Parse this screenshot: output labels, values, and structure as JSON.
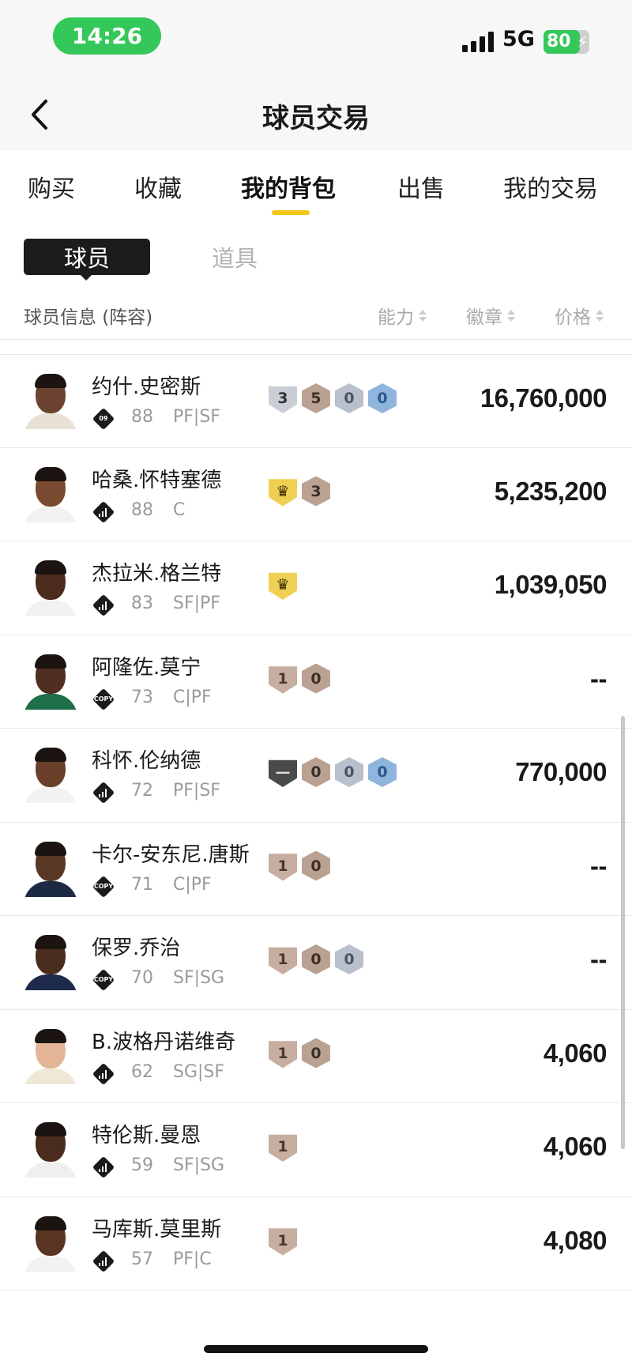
{
  "status_bar": {
    "time": "14:26",
    "network": "5G",
    "battery": "80",
    "battery_level": 0.8
  },
  "nav": {
    "title": "球员交易"
  },
  "main_tabs": [
    {
      "label": "购买"
    },
    {
      "label": "收藏"
    },
    {
      "label": "我的背包",
      "active": true
    },
    {
      "label": "出售"
    },
    {
      "label": "我的交易"
    }
  ],
  "sub_tabs": [
    {
      "label": "球员",
      "active": true
    },
    {
      "label": "道具"
    }
  ],
  "columns": {
    "info": "球员信息 (阵容)",
    "ability": "能力",
    "badge": "徽章",
    "price": "价格"
  },
  "colors": {
    "accent": "#f5c518",
    "status_green": "#34c759"
  },
  "players": [
    {
      "name": "约什.史密斯",
      "card": "09",
      "rating": "88",
      "position": "PF|SF",
      "price": "16,760,000",
      "skin": "#6b4330",
      "jersey": "#e8e2d6",
      "badges": [
        {
          "type": "shield",
          "text": "3",
          "bg": "#c9ced6",
          "fg": "#333"
        },
        {
          "type": "hex",
          "text": "5",
          "bg": "#b9a292",
          "fg": "#3d2f26"
        },
        {
          "type": "hex",
          "text": "0",
          "bg": "#b8c0cc",
          "fg": "#4a5568"
        },
        {
          "type": "hex",
          "text": "0",
          "bg": "#8fb5dd",
          "fg": "#2e5a8a"
        }
      ]
    },
    {
      "name": "哈桑.怀特塞德",
      "card": "bars",
      "rating": "88",
      "position": "C",
      "price": "5,235,200",
      "skin": "#7a4a30",
      "jersey": "#f2f2f2",
      "badges": [
        {
          "type": "shield",
          "text": "♛",
          "bg": "#f0cf55",
          "fg": "#3a2d00"
        },
        {
          "type": "hex",
          "text": "3",
          "bg": "#b9a292",
          "fg": "#3d2f26"
        }
      ]
    },
    {
      "name": "杰拉米.格兰特",
      "card": "bars",
      "rating": "83",
      "position": "SF|PF",
      "price": "1,039,050",
      "skin": "#4b2c1e",
      "jersey": "#f2f2f2",
      "badges": [
        {
          "type": "shield",
          "text": "♛",
          "bg": "#f0cf55",
          "fg": "#3a2d00"
        }
      ]
    },
    {
      "name": "阿隆佐.莫宁",
      "card": "COPY",
      "rating": "73",
      "position": "C|PF",
      "price": "--",
      "skin": "#4e2f21",
      "jersey": "#1f6e4a",
      "badges": [
        {
          "type": "shield",
          "text": "1",
          "bg": "#c7aea0",
          "fg": "#4a382d"
        },
        {
          "type": "hex",
          "text": "0",
          "bg": "#b9a292",
          "fg": "#3d2f26"
        }
      ]
    },
    {
      "name": "科怀.伦纳德",
      "card": "bars",
      "rating": "72",
      "position": "PF|SF",
      "price": "770,000",
      "skin": "#6a3f2a",
      "jersey": "#f2f2f2",
      "badges": [
        {
          "type": "shield",
          "text": "—",
          "bg": "#4a4a4a",
          "fg": "#dddddd"
        },
        {
          "type": "hex",
          "text": "0",
          "bg": "#b9a292",
          "fg": "#3d2f26"
        },
        {
          "type": "hex",
          "text": "0",
          "bg": "#b8c0cc",
          "fg": "#4a5568"
        },
        {
          "type": "hex",
          "text": "0",
          "bg": "#8fb5dd",
          "fg": "#2e5a8a"
        }
      ]
    },
    {
      "name": "卡尔-安东尼.唐斯",
      "card": "COPY",
      "rating": "71",
      "position": "C|PF",
      "price": "--",
      "skin": "#5a3826",
      "jersey": "#1c2a44",
      "badges": [
        {
          "type": "shield",
          "text": "1",
          "bg": "#c7aea0",
          "fg": "#4a382d"
        },
        {
          "type": "hex",
          "text": "0",
          "bg": "#b9a292",
          "fg": "#3d2f26"
        }
      ]
    },
    {
      "name": "保罗.乔治",
      "card": "COPY",
      "rating": "70",
      "position": "SF|SG",
      "price": "--",
      "skin": "#4a2c1e",
      "jersey": "#1d2a4a",
      "badges": [
        {
          "type": "shield",
          "text": "1",
          "bg": "#c7aea0",
          "fg": "#4a382d"
        },
        {
          "type": "hex",
          "text": "0",
          "bg": "#b9a292",
          "fg": "#3d2f26"
        },
        {
          "type": "hex",
          "text": "0",
          "bg": "#b8c0cc",
          "fg": "#4a5568"
        }
      ]
    },
    {
      "name": "B.波格丹诺维奇",
      "card": "bars",
      "rating": "62",
      "position": "SG|SF",
      "price": "4,060",
      "skin": "#e3b596",
      "jersey": "#efe7d8",
      "badges": [
        {
          "type": "shield",
          "text": "1",
          "bg": "#c7aea0",
          "fg": "#4a382d"
        },
        {
          "type": "hex",
          "text": "0",
          "bg": "#b9a292",
          "fg": "#3d2f26"
        }
      ]
    },
    {
      "name": "特伦斯.曼恩",
      "card": "bars",
      "rating": "59",
      "position": "SF|SG",
      "price": "4,060",
      "skin": "#4a2c1e",
      "jersey": "#efefef",
      "badges": [
        {
          "type": "shield",
          "text": "1",
          "bg": "#c7aea0",
          "fg": "#4a382d"
        }
      ]
    },
    {
      "name": "马库斯.莫里斯",
      "card": "bars",
      "rating": "57",
      "position": "PF|C",
      "price": "4,080",
      "skin": "#5a3422",
      "jersey": "#f2f2f2",
      "badges": [
        {
          "type": "shield",
          "text": "1",
          "bg": "#c7aea0",
          "fg": "#4a382d"
        }
      ]
    }
  ]
}
